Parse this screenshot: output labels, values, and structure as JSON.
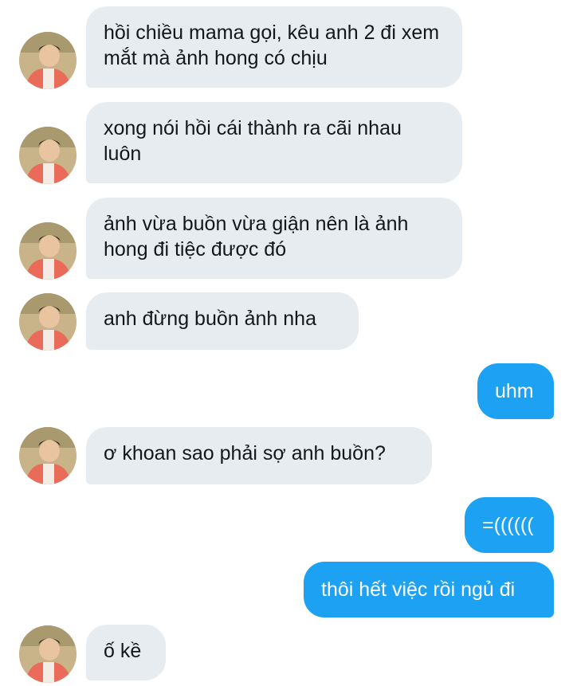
{
  "messages": [
    {
      "from": "them",
      "text": "hồi chiều mama gọi, kêu anh 2 đi xem mắt mà ảnh hong có chịu",
      "avatar": "avatar-photo"
    },
    {
      "from": "them",
      "text": "xong nói hồi cái thành ra cãi nhau luôn",
      "avatar": "avatar-photo"
    },
    {
      "from": "them",
      "text": "ảnh vừa buồn vừa giận nên là ảnh hong đi tiệc được đó",
      "avatar": "avatar-photo"
    },
    {
      "from": "them",
      "text": "anh đừng buồn ảnh nha",
      "avatar": "avatar-photo"
    },
    {
      "from": "me",
      "text": "uhm"
    },
    {
      "from": "them",
      "text": "ơ khoan sao phải sợ anh buồn?",
      "avatar": "avatar-photo"
    },
    {
      "from": "me",
      "text": "=(((((("
    },
    {
      "from": "me",
      "text": "thôi hết việc rồi ngủ đi"
    },
    {
      "from": "them",
      "text": "ố kề",
      "avatar": "avatar-photo"
    }
  ],
  "colors": {
    "incoming_bubble": "#e6ecf0",
    "outgoing_bubble": "#1da1f2",
    "incoming_text": "#14171a",
    "outgoing_text": "#ffffff",
    "background": "#ffffff"
  }
}
